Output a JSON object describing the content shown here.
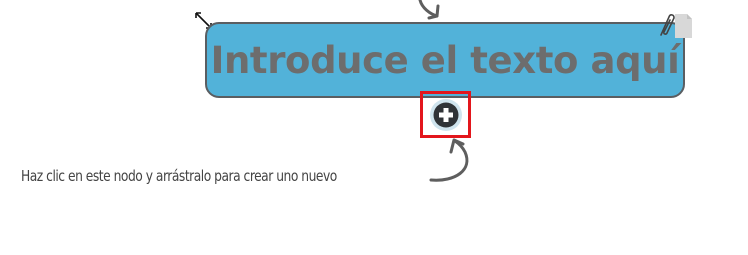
{
  "node": {
    "text": "Introduce el texto aquí",
    "fill_color": "#52b2d9",
    "border_color": "#5a5e62",
    "text_color": "#6d6d6d"
  },
  "hint": {
    "text": "Haz clic en este nodo y arrástralo para crear uno nuevo"
  },
  "icons": {
    "resize": "resize-arrows-icon",
    "attach": "paperclip-icon",
    "add": "plus-circle-icon"
  },
  "highlight_color": "#e3161c"
}
